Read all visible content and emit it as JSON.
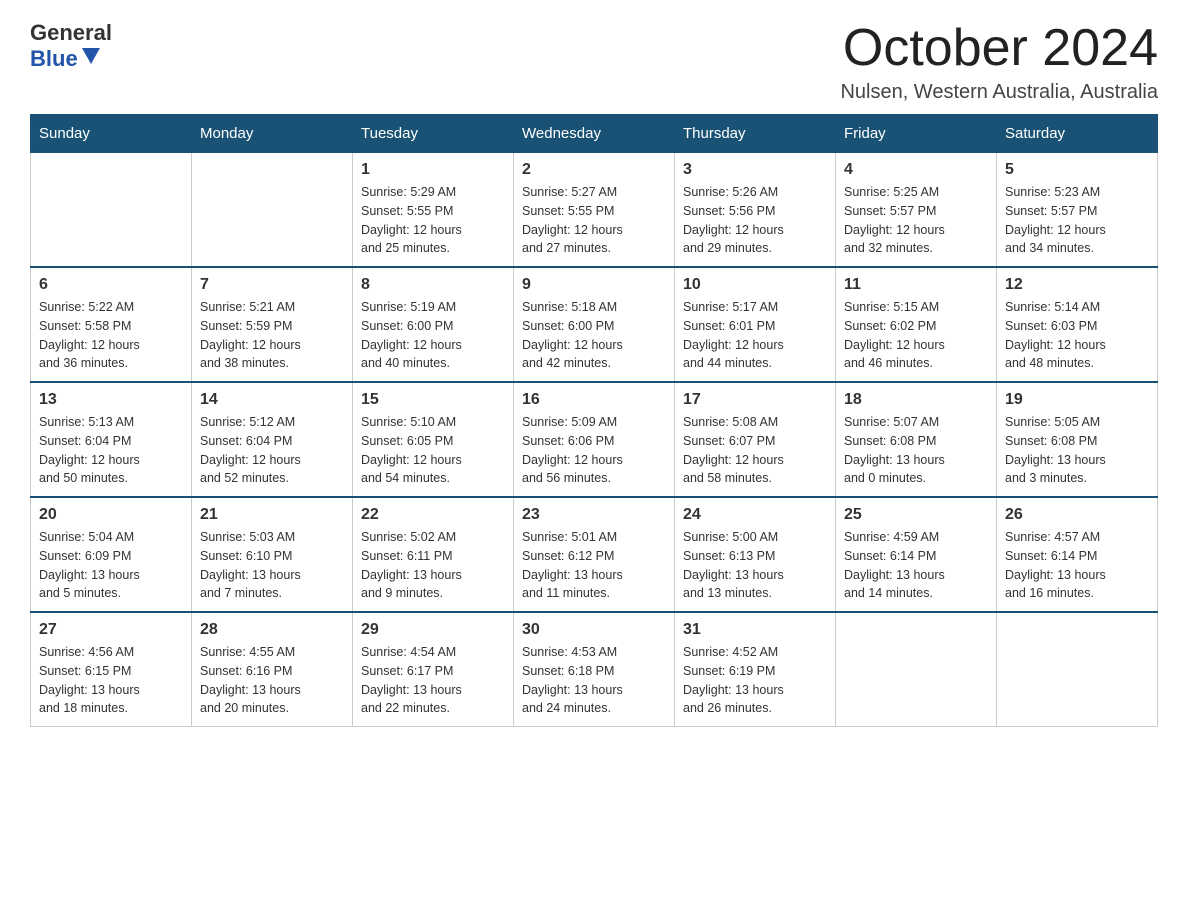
{
  "header": {
    "logo_general": "General",
    "logo_blue": "Blue",
    "title": "October 2024",
    "location": "Nulsen, Western Australia, Australia"
  },
  "days_of_week": [
    "Sunday",
    "Monday",
    "Tuesday",
    "Wednesday",
    "Thursday",
    "Friday",
    "Saturday"
  ],
  "weeks": [
    [
      {
        "date": "",
        "info": ""
      },
      {
        "date": "",
        "info": ""
      },
      {
        "date": "1",
        "info": "Sunrise: 5:29 AM\nSunset: 5:55 PM\nDaylight: 12 hours\nand 25 minutes."
      },
      {
        "date": "2",
        "info": "Sunrise: 5:27 AM\nSunset: 5:55 PM\nDaylight: 12 hours\nand 27 minutes."
      },
      {
        "date": "3",
        "info": "Sunrise: 5:26 AM\nSunset: 5:56 PM\nDaylight: 12 hours\nand 29 minutes."
      },
      {
        "date": "4",
        "info": "Sunrise: 5:25 AM\nSunset: 5:57 PM\nDaylight: 12 hours\nand 32 minutes."
      },
      {
        "date": "5",
        "info": "Sunrise: 5:23 AM\nSunset: 5:57 PM\nDaylight: 12 hours\nand 34 minutes."
      }
    ],
    [
      {
        "date": "6",
        "info": "Sunrise: 5:22 AM\nSunset: 5:58 PM\nDaylight: 12 hours\nand 36 minutes."
      },
      {
        "date": "7",
        "info": "Sunrise: 5:21 AM\nSunset: 5:59 PM\nDaylight: 12 hours\nand 38 minutes."
      },
      {
        "date": "8",
        "info": "Sunrise: 5:19 AM\nSunset: 6:00 PM\nDaylight: 12 hours\nand 40 minutes."
      },
      {
        "date": "9",
        "info": "Sunrise: 5:18 AM\nSunset: 6:00 PM\nDaylight: 12 hours\nand 42 minutes."
      },
      {
        "date": "10",
        "info": "Sunrise: 5:17 AM\nSunset: 6:01 PM\nDaylight: 12 hours\nand 44 minutes."
      },
      {
        "date": "11",
        "info": "Sunrise: 5:15 AM\nSunset: 6:02 PM\nDaylight: 12 hours\nand 46 minutes."
      },
      {
        "date": "12",
        "info": "Sunrise: 5:14 AM\nSunset: 6:03 PM\nDaylight: 12 hours\nand 48 minutes."
      }
    ],
    [
      {
        "date": "13",
        "info": "Sunrise: 5:13 AM\nSunset: 6:04 PM\nDaylight: 12 hours\nand 50 minutes."
      },
      {
        "date": "14",
        "info": "Sunrise: 5:12 AM\nSunset: 6:04 PM\nDaylight: 12 hours\nand 52 minutes."
      },
      {
        "date": "15",
        "info": "Sunrise: 5:10 AM\nSunset: 6:05 PM\nDaylight: 12 hours\nand 54 minutes."
      },
      {
        "date": "16",
        "info": "Sunrise: 5:09 AM\nSunset: 6:06 PM\nDaylight: 12 hours\nand 56 minutes."
      },
      {
        "date": "17",
        "info": "Sunrise: 5:08 AM\nSunset: 6:07 PM\nDaylight: 12 hours\nand 58 minutes."
      },
      {
        "date": "18",
        "info": "Sunrise: 5:07 AM\nSunset: 6:08 PM\nDaylight: 13 hours\nand 0 minutes."
      },
      {
        "date": "19",
        "info": "Sunrise: 5:05 AM\nSunset: 6:08 PM\nDaylight: 13 hours\nand 3 minutes."
      }
    ],
    [
      {
        "date": "20",
        "info": "Sunrise: 5:04 AM\nSunset: 6:09 PM\nDaylight: 13 hours\nand 5 minutes."
      },
      {
        "date": "21",
        "info": "Sunrise: 5:03 AM\nSunset: 6:10 PM\nDaylight: 13 hours\nand 7 minutes."
      },
      {
        "date": "22",
        "info": "Sunrise: 5:02 AM\nSunset: 6:11 PM\nDaylight: 13 hours\nand 9 minutes."
      },
      {
        "date": "23",
        "info": "Sunrise: 5:01 AM\nSunset: 6:12 PM\nDaylight: 13 hours\nand 11 minutes."
      },
      {
        "date": "24",
        "info": "Sunrise: 5:00 AM\nSunset: 6:13 PM\nDaylight: 13 hours\nand 13 minutes."
      },
      {
        "date": "25",
        "info": "Sunrise: 4:59 AM\nSunset: 6:14 PM\nDaylight: 13 hours\nand 14 minutes."
      },
      {
        "date": "26",
        "info": "Sunrise: 4:57 AM\nSunset: 6:14 PM\nDaylight: 13 hours\nand 16 minutes."
      }
    ],
    [
      {
        "date": "27",
        "info": "Sunrise: 4:56 AM\nSunset: 6:15 PM\nDaylight: 13 hours\nand 18 minutes."
      },
      {
        "date": "28",
        "info": "Sunrise: 4:55 AM\nSunset: 6:16 PM\nDaylight: 13 hours\nand 20 minutes."
      },
      {
        "date": "29",
        "info": "Sunrise: 4:54 AM\nSunset: 6:17 PM\nDaylight: 13 hours\nand 22 minutes."
      },
      {
        "date": "30",
        "info": "Sunrise: 4:53 AM\nSunset: 6:18 PM\nDaylight: 13 hours\nand 24 minutes."
      },
      {
        "date": "31",
        "info": "Sunrise: 4:52 AM\nSunset: 6:19 PM\nDaylight: 13 hours\nand 26 minutes."
      },
      {
        "date": "",
        "info": ""
      },
      {
        "date": "",
        "info": ""
      }
    ]
  ]
}
